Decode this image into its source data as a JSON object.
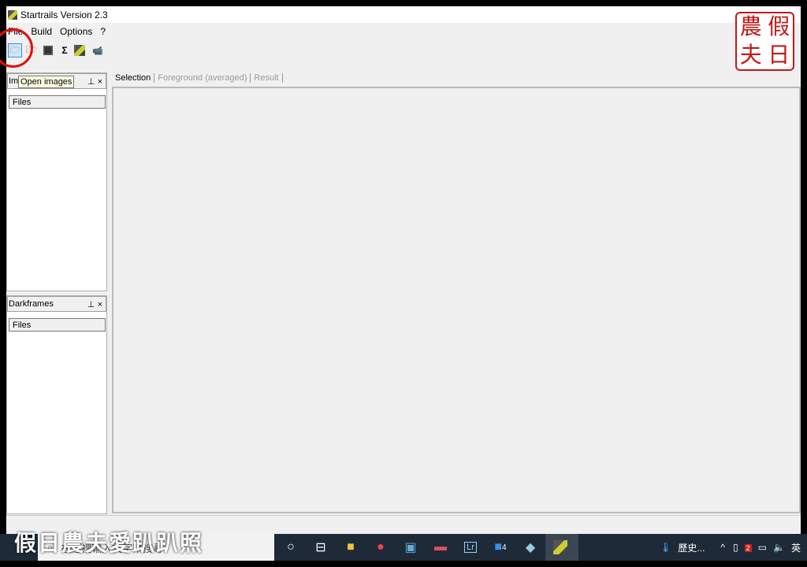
{
  "window": {
    "title": "Startrails Version 2.3"
  },
  "menu": [
    "File",
    "Build",
    "Options",
    "?"
  ],
  "toolbar": {
    "tooltip": "Open images",
    "icons": [
      "open-folder",
      "open-darkframes",
      "save",
      "sum",
      "startrails",
      "video"
    ]
  },
  "images_panel": {
    "title": "Images",
    "column": "Files"
  },
  "darkframes_panel": {
    "title": "Darkframes",
    "column": "Files"
  },
  "tabs": [
    "Selection",
    "Foreground (averaged)",
    "Result"
  ],
  "taskbar": {
    "search_placeholder": "在這裡輸入文字來搜尋",
    "weather": "歷史...",
    "badge_count": "4",
    "ime": "英",
    "mail_count": "2"
  },
  "stamp": [
    "農",
    "假",
    "夫",
    "日"
  ],
  "watermark": "假日農夫愛趴趴照",
  "colors": {
    "accent": "#c41818",
    "taskbar": "#1e2a38"
  }
}
